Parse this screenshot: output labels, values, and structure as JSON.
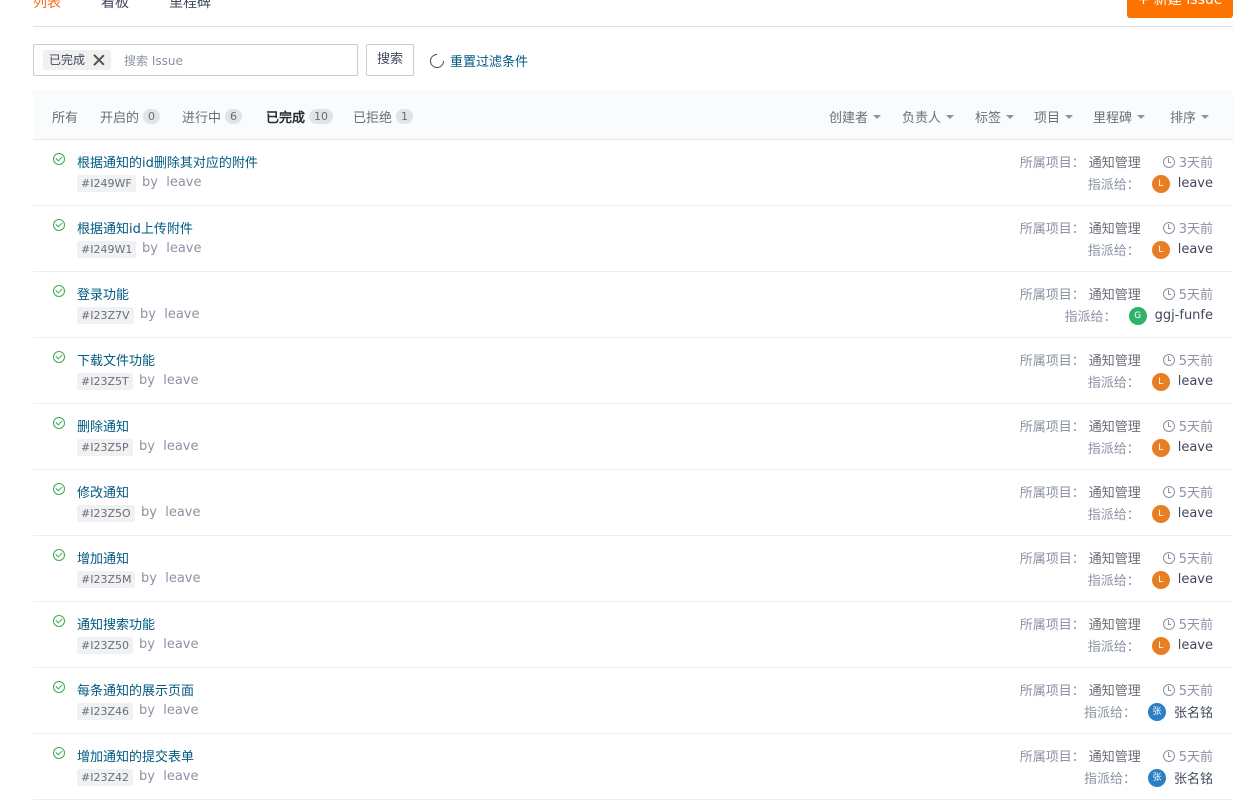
{
  "top_tabs": [
    "列表",
    "看板",
    "里程碑"
  ],
  "new_issue_button": "+ 新建 Issue",
  "search": {
    "chip": "已完成",
    "placeholder": "搜索 Issue",
    "button": "搜索",
    "reset": "重置过滤条件"
  },
  "status_tabs": [
    {
      "label": "所有",
      "count": ""
    },
    {
      "label": "开启的",
      "count": "0"
    },
    {
      "label": "进行中",
      "count": "6"
    },
    {
      "label": "已完成",
      "count": "10"
    },
    {
      "label": "已拒绝",
      "count": "1"
    }
  ],
  "dropdowns": [
    "创建者",
    "负责人",
    "标签",
    "项目",
    "里程碑",
    "排序"
  ],
  "labels": {
    "project": "所属项目：",
    "assigned": "指派给：",
    "by": "by"
  },
  "colors": {
    "accent": "#fe7300",
    "link": "#005980",
    "done": "#3eaa4f",
    "avatar_orange": "#e87e22",
    "avatar_green": "#2fb36b",
    "avatar_blue": "#2a7fc5"
  },
  "issues": [
    {
      "title": "根据通知的id删除其对应的附件",
      "id": "#I249WF",
      "author": "leave",
      "project": "通知管理",
      "time": "3天前",
      "assignee": "leave",
      "avatar": "L",
      "avatar_color": "#e87e22"
    },
    {
      "title": "根据通知id上传附件",
      "id": "#I249W1",
      "author": "leave",
      "project": "通知管理",
      "time": "3天前",
      "assignee": "leave",
      "avatar": "L",
      "avatar_color": "#e87e22"
    },
    {
      "title": "登录功能",
      "id": "#I23Z7V",
      "author": "leave",
      "project": "通知管理",
      "time": "5天前",
      "assignee": "ggj-funfe",
      "avatar": "G",
      "avatar_color": "#2fb36b"
    },
    {
      "title": "下载文件功能",
      "id": "#I23Z5T",
      "author": "leave",
      "project": "通知管理",
      "time": "5天前",
      "assignee": "leave",
      "avatar": "L",
      "avatar_color": "#e87e22"
    },
    {
      "title": "删除通知",
      "id": "#I23Z5P",
      "author": "leave",
      "project": "通知管理",
      "time": "5天前",
      "assignee": "leave",
      "avatar": "L",
      "avatar_color": "#e87e22"
    },
    {
      "title": "修改通知",
      "id": "#I23Z5O",
      "author": "leave",
      "project": "通知管理",
      "time": "5天前",
      "assignee": "leave",
      "avatar": "L",
      "avatar_color": "#e87e22"
    },
    {
      "title": "增加通知",
      "id": "#I23Z5M",
      "author": "leave",
      "project": "通知管理",
      "time": "5天前",
      "assignee": "leave",
      "avatar": "L",
      "avatar_color": "#e87e22"
    },
    {
      "title": "通知搜索功能",
      "id": "#I23Z50",
      "author": "leave",
      "project": "通知管理",
      "time": "5天前",
      "assignee": "leave",
      "avatar": "L",
      "avatar_color": "#e87e22"
    },
    {
      "title": "每条通知的展示页面",
      "id": "#I23Z46",
      "author": "leave",
      "project": "通知管理",
      "time": "5天前",
      "assignee": "张名铭",
      "avatar": "张",
      "avatar_color": "#2a7fc5"
    },
    {
      "title": "增加通知的提交表单",
      "id": "#I23Z42",
      "author": "leave",
      "project": "通知管理",
      "time": "5天前",
      "assignee": "张名铭",
      "avatar": "张",
      "avatar_color": "#2a7fc5"
    }
  ]
}
